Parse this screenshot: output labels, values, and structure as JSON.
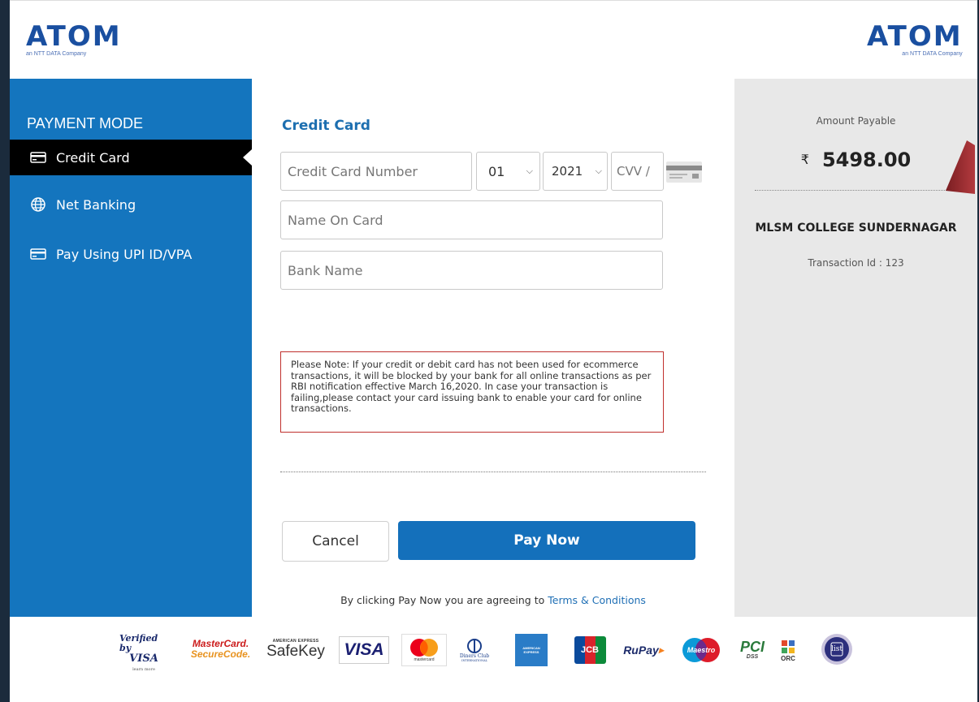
{
  "header": {
    "logo_left": {
      "word": "ATOM",
      "sub": "an NTT DATA Company"
    },
    "logo_right": {
      "word": "ATOM",
      "sub": "an NTT DATA Company"
    }
  },
  "sidebar": {
    "title": "PAYMENT MODE",
    "items": [
      {
        "label": "Credit Card",
        "icon": "credit-card-icon",
        "active": true
      },
      {
        "label": "Net Banking",
        "icon": "globe-icon",
        "active": false
      },
      {
        "label": "Pay Using UPI ID/VPA",
        "icon": "credit-card-icon",
        "active": false
      }
    ]
  },
  "form": {
    "title": "Credit Card",
    "card_number_placeholder": "Credit Card Number",
    "month_value": "01",
    "year_value": "2021",
    "cvv_placeholder": "CVV /",
    "name_placeholder": "Name On Card",
    "bank_placeholder": "Bank Name",
    "note": "Please Note: If your credit or debit card has not been used for ecommerce transactions, it will be blocked by your bank for all online transactions as per RBI notification effective March 16,2020. In case your transaction is failing,please contact your card issuing bank to enable your card for online transactions.",
    "cancel_label": "Cancel",
    "pay_label": "Pay Now",
    "terms_prefix": "By clicking Pay Now you are agreeing to",
    "terms_link": "Terms & Conditions"
  },
  "summary": {
    "amount_label": "Amount Payable",
    "currency_symbol": "₹",
    "amount": "5498.00",
    "merchant": "MLSM COLLEGE SUNDERNAGAR",
    "transaction": "Transaction Id : 123"
  },
  "footer_logos": {
    "verified_visa": {
      "line1": "Verified by",
      "line2": "VISA",
      "line3": "learn more"
    },
    "mastercard_securecode": {
      "line1": "MasterCard.",
      "line2": "SecureCode."
    },
    "amex_safekey": {
      "line1": "AMERICAN EXPRESS",
      "line2": "SafeKey"
    },
    "visa": "VISA",
    "mastercard": "mastercard",
    "diners": {
      "line1": "Diners Club",
      "line2": "INTERNATIONAL"
    },
    "amex": "AMERICAN EXPRESS",
    "jcb": "JCB",
    "rupay": "RuPay",
    "maestro": "Maestro",
    "pci": {
      "line1": "PCI",
      "line2": "DSS"
    },
    "orc": "ORC",
    "list_badge": "list"
  },
  "colors": {
    "sidebar_bg": "#1475be",
    "active_item_bg": "#000000",
    "primary_button": "#1470bb",
    "summary_bg": "#e8e8e8",
    "note_border": "#c0302d"
  }
}
